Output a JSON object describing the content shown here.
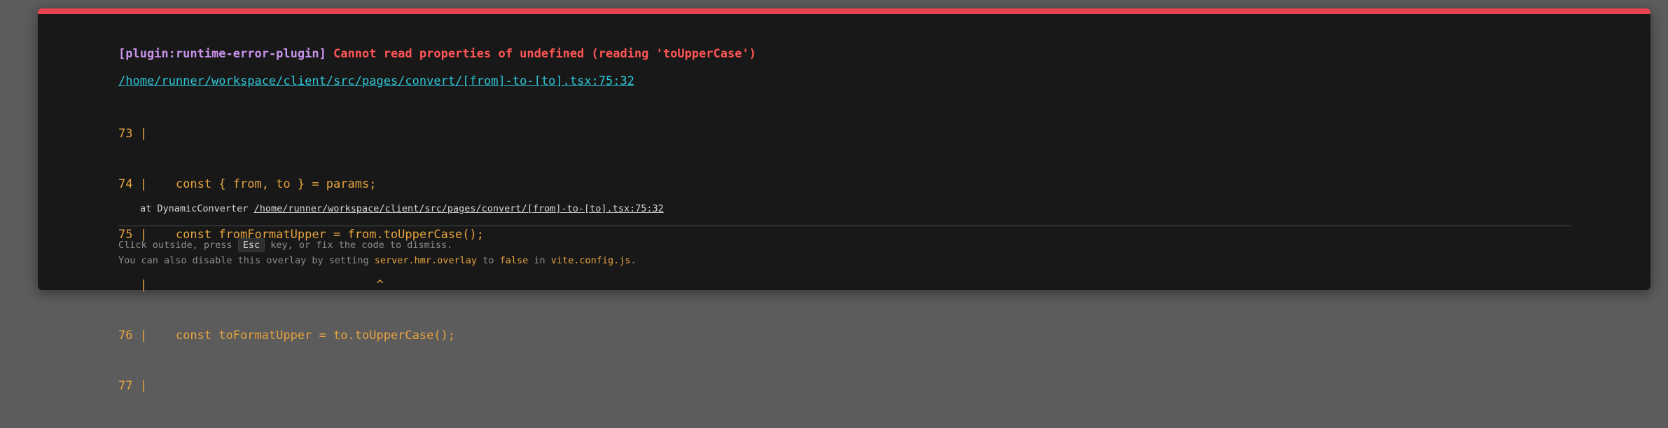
{
  "error": {
    "plugin": "[plugin:runtime-error-plugin]",
    "message": "Cannot read properties of undefined (reading 'toUpperCase')"
  },
  "file": {
    "path": "/home/runner/workspace/client/src/pages/convert/[from]-to-[to].tsx:75:32"
  },
  "frame": {
    "lines": [
      "73 |",
      "74 |    const { from, to } = params;",
      "75 |    const fromFormatUpper = from.toUpperCase();",
      "   |                                ^",
      "76 |    const toFormatUpper = to.toUpperCase();",
      "77 |"
    ]
  },
  "stack": {
    "prefix": "at DynamicConverter ",
    "link": "/home/runner/workspace/client/src/pages/convert/[from]-to-[to].tsx:75:32"
  },
  "tip": {
    "line1_pre": "Click outside, press ",
    "line1_key": "Esc",
    "line1_post": " key, or fix the code to dismiss.",
    "line2_pre": "You can also disable this overlay by setting ",
    "line2_setting": "server.hmr.overlay",
    "line2_to": " to ",
    "line2_value": "false",
    "line2_in": " in ",
    "line2_file": "vite.config.js",
    "line2_end": "."
  },
  "colors": {
    "accent": "#e8434f",
    "plugin": "#c792ea",
    "error": "#ff5555",
    "link": "#2dc8d8",
    "code": "#e6a33f",
    "background": "#181818"
  }
}
